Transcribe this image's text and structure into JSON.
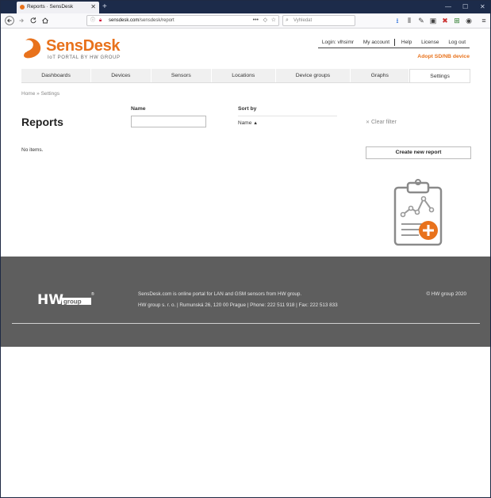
{
  "browser": {
    "tab_title": "Reports · SensDesk",
    "tab_close": "✕",
    "new_tab": "+",
    "window_controls": [
      "—",
      "☐",
      "✕"
    ],
    "url_host": "sensdesk.com",
    "url_path": "/sensdesk/report",
    "search_placeholder": "Vyhledat",
    "icons": [
      "back-icon",
      "forward-icon",
      "reload-icon",
      "home-icon",
      "download-icon",
      "library-icon",
      "extensions-icon",
      "sidebar-icon",
      "menu-icon"
    ]
  },
  "brand": {
    "name_a": "Sens",
    "name_b": "Desk",
    "tagline": "IoT PORTAL BY HW GROUP",
    "accent": "#e8721c"
  },
  "user": {
    "login": "Login: vlhsimr",
    "my_account": "My account",
    "help": "Help",
    "license": "License",
    "logout": "Log out",
    "adopt": "Adopt SD/NB device"
  },
  "menu": [
    {
      "label": "Dashboards",
      "active": false
    },
    {
      "label": "Devices",
      "active": false
    },
    {
      "label": "Sensors",
      "active": false
    },
    {
      "label": "Locations",
      "active": false
    },
    {
      "label": "Device groups",
      "active": false
    },
    {
      "label": "Graphs",
      "active": false
    },
    {
      "label": "Settings",
      "active": true
    }
  ],
  "breadcrumb": {
    "home": "Home",
    "sep": "»",
    "current": "Settings"
  },
  "page": {
    "title": "Reports",
    "name_label": "Name",
    "name_value": "",
    "sort_label": "Sort by",
    "sort_value": "Name",
    "sort_icon": "▲",
    "clear_filter": "Clear filter",
    "clear_icon": "✕",
    "no_items": "No items.",
    "create_button": "Create new report"
  },
  "footer": {
    "logo_text": "HW group",
    "desc": "SensDesk.com is online portal for LAN and GSM sensors from HW group.",
    "address": "HW group s. r. o. | Rumunská 26, 120 00 Prague | Phone: 222 511 918 | Fax: 222 513 833",
    "copyright": "© HW group 2020"
  }
}
